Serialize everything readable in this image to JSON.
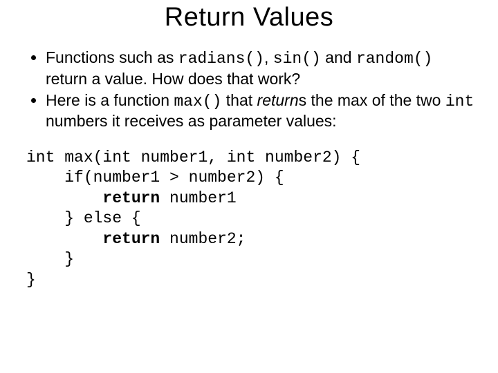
{
  "title": "Return Values",
  "bullets": {
    "b1": {
      "pre": "Functions such as ",
      "c1": "radians()",
      "mid1": ", ",
      "c2": "sin()",
      "mid2": " and ",
      "c3": "random()",
      "post": " return a value.  How does that work?"
    },
    "b2": {
      "pre": "Here is a function ",
      "c1": "max()",
      "mid1": " that ",
      "it": "return",
      "mid2": "s the max of the two ",
      "c2": "int",
      "post": " numbers it receives as parameter values:"
    }
  },
  "code": {
    "l1a": "int max(int number1, int number2) {",
    "l2a": "    if(number1 > number2) {",
    "l3a": "        ",
    "l3b": "return",
    "l3c": " number1",
    "l4a": "    } else {",
    "l5a": "        ",
    "l5b": "return",
    "l5c": " number2;",
    "l6a": "    }",
    "l7a": "}"
  }
}
